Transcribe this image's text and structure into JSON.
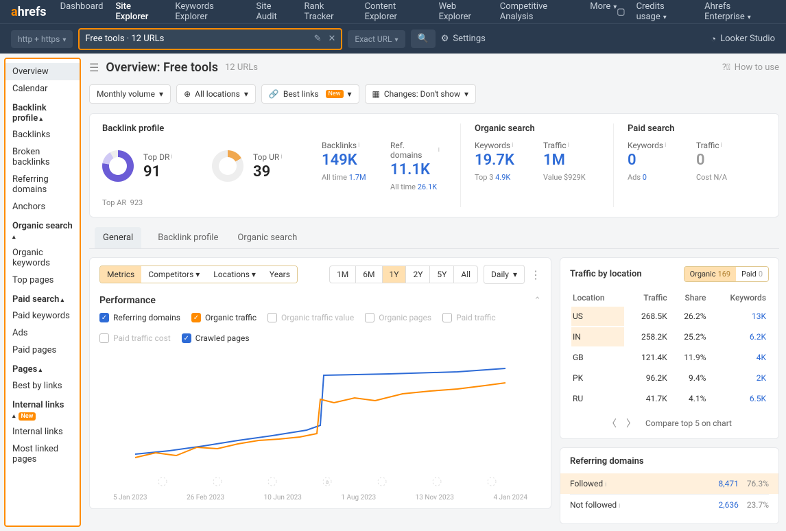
{
  "topnav": {
    "logo_a": "a",
    "logo_rest": "hrefs",
    "items": [
      "Dashboard",
      "Site Explorer",
      "Keywords Explorer",
      "Site Audit",
      "Rank Tracker",
      "Content Explorer",
      "Web Explorer",
      "Competitive Analysis",
      "More"
    ],
    "active_index": 1,
    "credits": "Credits usage",
    "plan": "Ahrefs Enterprise"
  },
  "searchrow": {
    "protocol": "http + https",
    "search_text": "Free tools · 12 URLs",
    "exact": "Exact URL",
    "settings": "Settings",
    "looker": "Looker Studio"
  },
  "sidebar": {
    "top": [
      {
        "label": "Overview",
        "active": true
      },
      {
        "label": "Calendar"
      }
    ],
    "groups": [
      {
        "head": "Backlink profile",
        "items": [
          "Backlinks",
          "Broken backlinks",
          "Referring domains",
          "Anchors"
        ]
      },
      {
        "head": "Organic search",
        "items": [
          "Organic keywords",
          "Top pages"
        ]
      },
      {
        "head": "Paid search",
        "items": [
          "Paid keywords",
          "Ads",
          "Paid pages"
        ]
      },
      {
        "head": "Pages",
        "items": [
          "Best by links"
        ]
      },
      {
        "head": "Internal links",
        "new": true,
        "items": [
          "Internal links",
          "Most linked pages"
        ]
      }
    ]
  },
  "page": {
    "title": "Overview: Free tools",
    "url_count": "12 URLs",
    "howto": "How to use"
  },
  "filters": {
    "volume": "Monthly volume",
    "locations": "All locations",
    "bestlinks": "Best links",
    "bestlinks_badge": "New",
    "changes": "Changes: Don't show"
  },
  "metrics": {
    "backlink": {
      "head": "Backlink profile",
      "top_dr_label": "Top DR",
      "top_dr_val": "91",
      "top_ur_label": "Top UR",
      "top_ur_val": "39",
      "backlinks_label": "Backlinks",
      "backlinks_val": "149K",
      "backlinks_sub_l": "All time",
      "backlinks_sub_v": "1.7M",
      "refd_label": "Ref. domains",
      "refd_val": "11.1K",
      "refd_sub_l": "All time",
      "refd_sub_v": "26.1K",
      "top_ar_label": "Top AR",
      "top_ar_val": "923"
    },
    "organic": {
      "head": "Organic search",
      "kw_label": "Keywords",
      "kw_val": "19.7K",
      "kw_sub_l": "Top 3",
      "kw_sub_v": "4.9K",
      "tr_label": "Traffic",
      "tr_val": "1M",
      "tr_sub_l": "Value",
      "tr_sub_v": "$929K"
    },
    "paid": {
      "head": "Paid search",
      "kw_label": "Keywords",
      "kw_val": "0",
      "kw_sub_l": "Ads",
      "kw_sub_v": "0",
      "tr_label": "Traffic",
      "tr_val": "0",
      "tr_sub_l": "Cost",
      "tr_sub_v": "N/A"
    }
  },
  "tabs": [
    "General",
    "Backlink profile",
    "Organic search"
  ],
  "chart_toolbar": {
    "seg": [
      "Metrics",
      "Competitors",
      "Locations",
      "Years"
    ],
    "ranges": [
      "1M",
      "6M",
      "1Y",
      "2Y",
      "5Y",
      "All"
    ],
    "range_active": 2,
    "daily": "Daily"
  },
  "perf": {
    "title": "Performance",
    "legend": [
      {
        "label": "Referring domains",
        "color": "#2e6bd6",
        "checked": true
      },
      {
        "label": "Organic traffic",
        "color": "#ff8b00",
        "checked": true
      },
      {
        "label": "Organic traffic value",
        "checked": false
      },
      {
        "label": "Organic pages",
        "checked": false
      },
      {
        "label": "Paid traffic",
        "checked": false
      },
      {
        "label": "Paid traffic cost",
        "checked": false
      },
      {
        "label": "Crawled pages",
        "color": "#2e6bd6",
        "checked": true
      }
    ],
    "xaxis": [
      "5 Jan 2023",
      "26 Feb 2023",
      "10 Jun 2023",
      "1 Aug 2023",
      "13 Nov 2023",
      "4 Jan 2024"
    ]
  },
  "chart_data": {
    "type": "line",
    "xlabel": "",
    "ylabel": "",
    "x_range": [
      "2023-01-05",
      "2024-01-04"
    ],
    "series": [
      {
        "name": "Referring domains",
        "color": "#2e6bd6",
        "y": [
          5600,
          5800,
          6100,
          6400,
          6700,
          7000,
          7300,
          7600,
          11000,
          11050,
          11080,
          11100
        ]
      },
      {
        "name": "Organic traffic",
        "color": "#ff8b00",
        "y": [
          420000,
          460000,
          500000,
          540000,
          560000,
          580000,
          820000,
          850000,
          870000,
          900000,
          950000,
          1000000
        ]
      }
    ]
  },
  "traffic_by_location": {
    "title": "Traffic by location",
    "pills": [
      {
        "label": "Organic",
        "count": "169",
        "active": true
      },
      {
        "label": "Paid",
        "count": "0"
      }
    ],
    "cols": [
      "Location",
      "Traffic",
      "Share",
      "Keywords"
    ],
    "rows": [
      {
        "loc": "US",
        "traffic": "268.5K",
        "share": "26.2%",
        "kw": "13K",
        "hl": true
      },
      {
        "loc": "IN",
        "traffic": "258.2K",
        "share": "25.2%",
        "kw": "6.2K",
        "hl": true
      },
      {
        "loc": "GB",
        "traffic": "121.4K",
        "share": "11.9%",
        "kw": "4K"
      },
      {
        "loc": "PK",
        "traffic": "96.2K",
        "share": "9.4%",
        "kw": "2K"
      },
      {
        "loc": "RU",
        "traffic": "41.7K",
        "share": "4.1%",
        "kw": "6.5K"
      }
    ],
    "compare": "Compare top 5 on chart"
  },
  "ref_domains": {
    "title": "Referring domains",
    "rows": [
      {
        "label": "Followed",
        "v1": "8,471",
        "v2": "76.3%",
        "hl": true
      },
      {
        "label": "Not followed",
        "v1": "2,636",
        "v2": "23.7%"
      }
    ]
  }
}
